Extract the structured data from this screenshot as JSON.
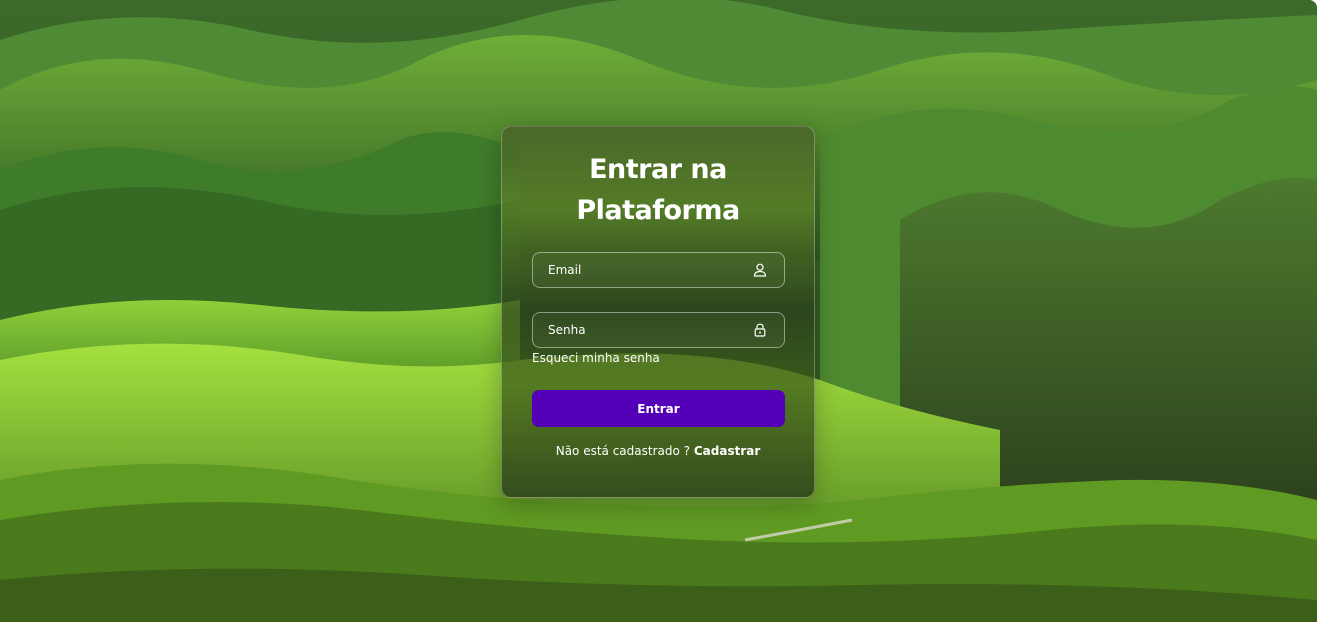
{
  "login": {
    "title_line1": "Entrar na",
    "title_line2": "Plataforma",
    "email": {
      "placeholder": "Email",
      "value": "",
      "icon": "user-icon"
    },
    "password": {
      "placeholder": "Senha",
      "value": "",
      "icon": "lock-icon"
    },
    "forgot_link": "Esqueci minha senha",
    "submit_label": "Entrar",
    "signup_prompt": "Não está cadastrado ?",
    "signup_link": "Cadastrar"
  },
  "colors": {
    "button": "#5400b8",
    "text": "#ffffff"
  }
}
